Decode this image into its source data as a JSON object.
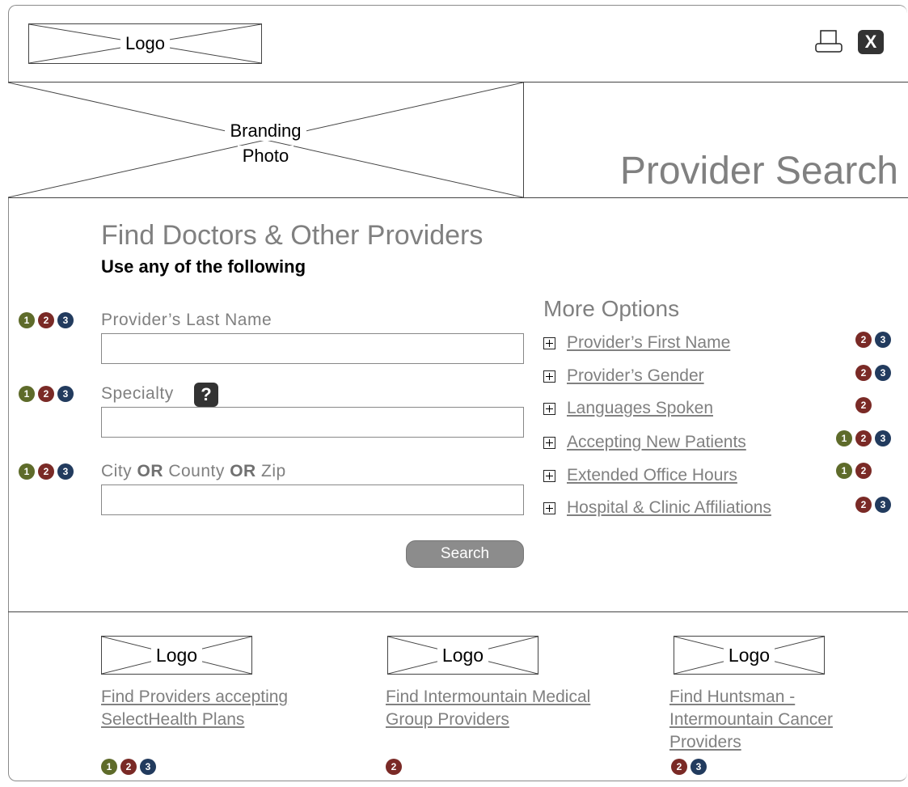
{
  "header": {
    "logo_label": "Logo",
    "close_label": "X"
  },
  "banner": {
    "branding_line1": "Branding",
    "branding_line2": "Photo",
    "title": "Provider Search"
  },
  "main": {
    "heading": "Find Doctors & Other Providers",
    "subheading": "Use any of the following",
    "fields": [
      {
        "label": "Provider’s Last Name",
        "value": "",
        "badges": [
          "1",
          "2",
          "3"
        ]
      },
      {
        "label": "Specialty",
        "value": "",
        "help": "?",
        "badges": [
          "1",
          "2",
          "3"
        ]
      },
      {
        "label_parts": [
          "City ",
          "OR",
          " County ",
          "OR",
          " Zip"
        ],
        "value": "",
        "badges": [
          "1",
          "2",
          "3"
        ]
      }
    ],
    "search_label": "Search"
  },
  "more_options": {
    "title": "More Options",
    "items": [
      {
        "label": "Provider’s First Name",
        "badges": [
          "2",
          "3"
        ]
      },
      {
        "label": "Provider’s Gender",
        "badges": [
          "2",
          "3"
        ]
      },
      {
        "label": "Languages Spoken",
        "badges": [
          "2"
        ]
      },
      {
        "label": "Accepting New Patients",
        "badges": [
          "1",
          "2",
          "3"
        ]
      },
      {
        "label": "Extended Office Hours",
        "badges": [
          "1",
          "2"
        ]
      },
      {
        "label": "Hospital & Clinic Affiliations",
        "badges": [
          "2",
          "3"
        ]
      }
    ]
  },
  "footer": {
    "cards": [
      {
        "logo": "Logo",
        "line1": "Find Providers accepting",
        "line2": "SelectHealth Plans",
        "line3": "",
        "badges": [
          "1",
          "2",
          "3"
        ]
      },
      {
        "logo": "Logo",
        "line1": "Find Intermountain Medical",
        "line2": "Group Providers",
        "line3": "",
        "badges": [
          "2"
        ]
      },
      {
        "logo": "Logo",
        "line1": "Find Huntsman -",
        "line2": "Intermountain Cancer",
        "line3": "Providers",
        "badges": [
          "2",
          "3"
        ]
      }
    ]
  },
  "colors": {
    "badge_1": "#5e6b2a",
    "badge_2": "#7a2a26",
    "badge_3": "#223b5e",
    "muted_text": "#808080"
  }
}
